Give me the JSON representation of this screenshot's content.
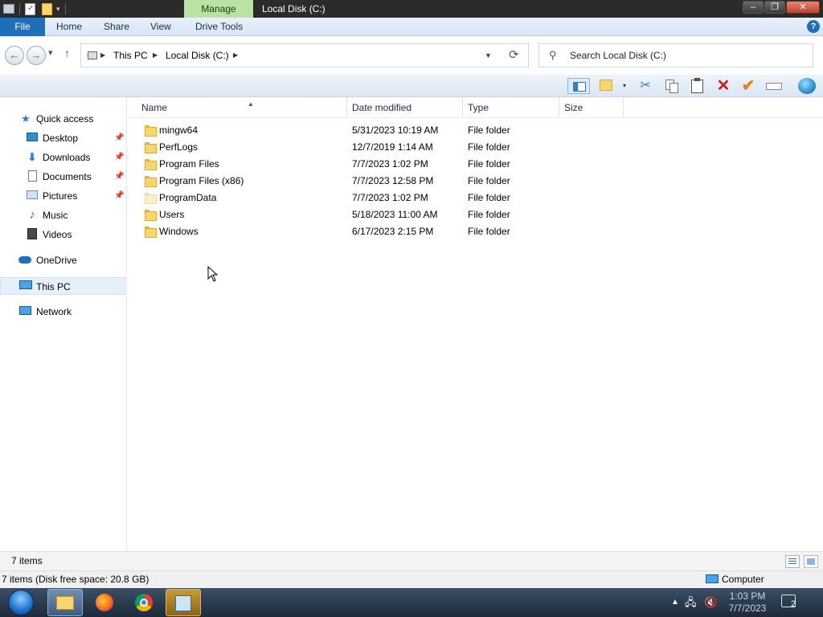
{
  "titlebar": {
    "context_tab": "Manage",
    "window_title": "Local Disk (C:)"
  },
  "ribbon": {
    "file_tab": "File",
    "tabs": [
      "Home",
      "Share",
      "View",
      "Drive Tools"
    ]
  },
  "address": {
    "crumbs": [
      "This PC",
      "Local Disk (C:)"
    ],
    "search_placeholder": "Search Local Disk (C:)"
  },
  "nav": {
    "quick_access": "Quick access",
    "items": [
      {
        "label": "Desktop",
        "icon": "desktop-icon",
        "pinned": true
      },
      {
        "label": "Downloads",
        "icon": "downloads-icon",
        "pinned": true
      },
      {
        "label": "Documents",
        "icon": "documents-icon",
        "pinned": true
      },
      {
        "label": "Pictures",
        "icon": "pictures-icon",
        "pinned": true
      },
      {
        "label": "Music",
        "icon": "music-icon",
        "pinned": false
      },
      {
        "label": "Videos",
        "icon": "videos-icon",
        "pinned": false
      }
    ],
    "onedrive": "OneDrive",
    "this_pc": "This PC",
    "network": "Network"
  },
  "columns": [
    "Name",
    "Date modified",
    "Type",
    "Size"
  ],
  "files": [
    {
      "name": "mingw64",
      "date": "5/31/2023 10:19 AM",
      "type": "File folder",
      "size": "",
      "hidden": false
    },
    {
      "name": "PerfLogs",
      "date": "12/7/2019 1:14 AM",
      "type": "File folder",
      "size": "",
      "hidden": false
    },
    {
      "name": "Program Files",
      "date": "7/7/2023 1:02 PM",
      "type": "File folder",
      "size": "",
      "hidden": false
    },
    {
      "name": "Program Files (x86)",
      "date": "7/7/2023 12:58 PM",
      "type": "File folder",
      "size": "",
      "hidden": false
    },
    {
      "name": "ProgramData",
      "date": "7/7/2023 1:02 PM",
      "type": "File folder",
      "size": "",
      "hidden": true
    },
    {
      "name": "Users",
      "date": "5/18/2023 11:00 AM",
      "type": "File folder",
      "size": "",
      "hidden": false
    },
    {
      "name": "Windows",
      "date": "6/17/2023 2:15 PM",
      "type": "File folder",
      "size": "",
      "hidden": false
    }
  ],
  "status": {
    "item_count": "7 items",
    "detail": "7 items (Disk free space: 20.8 GB)",
    "location": "Computer"
  },
  "taskbar": {
    "time": "1:03 PM",
    "date": "7/7/2023",
    "notifications": "2"
  },
  "colors": {
    "file_tab": "#1f6fb8",
    "manage_tab": "#b9e2a4",
    "folder": "#f8d66f",
    "delete": "#d01c1c",
    "check": "#e8831a"
  }
}
